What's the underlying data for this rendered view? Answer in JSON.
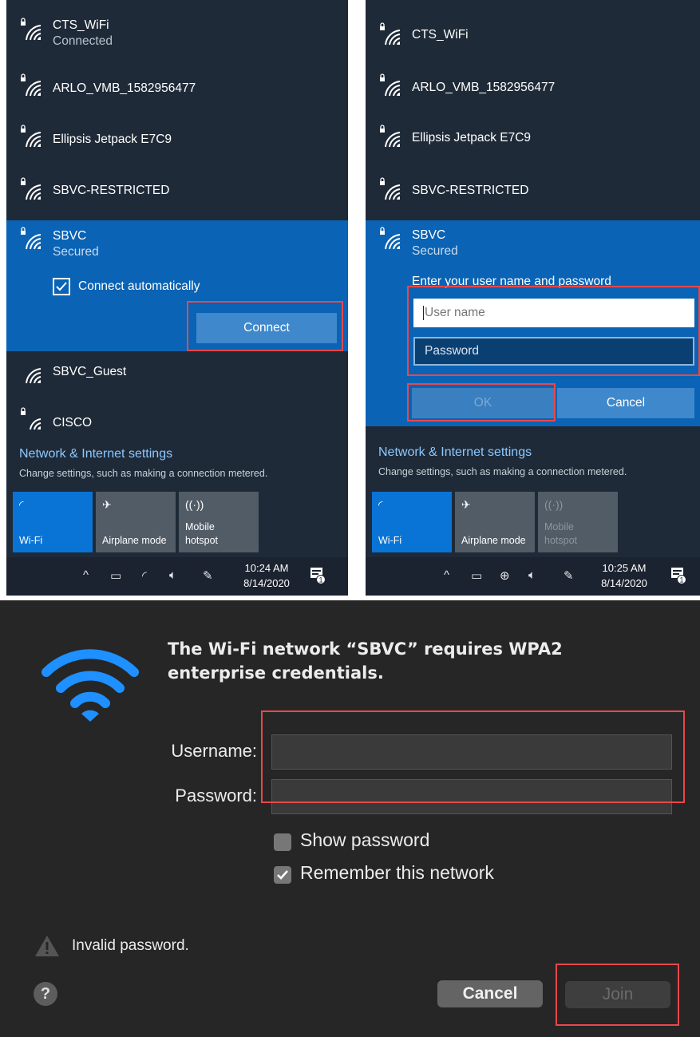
{
  "left_panel": {
    "networks": [
      {
        "name": "CTS_WiFi",
        "status": "Connected",
        "secured": true
      },
      {
        "name": "ARLO_VMB_1582956477",
        "status": "",
        "secured": true
      },
      {
        "name": "Ellipsis Jetpack E7C9",
        "status": "",
        "secured": true
      },
      {
        "name": "SBVC-RESTRICTED",
        "status": "",
        "secured": true
      }
    ],
    "selected": {
      "name": "SBVC",
      "status": "Secured",
      "connect_auto_label": "Connect automatically",
      "connect_auto_checked": true,
      "connect_button": "Connect"
    },
    "more_networks": [
      {
        "name": "SBVC_Guest",
        "secured": false
      },
      {
        "name": "CISCO",
        "secured": true
      }
    ],
    "settings_link": "Network & Internet settings",
    "settings_sub": "Change settings, such as making a connection metered.",
    "tiles": [
      {
        "label": "Wi-Fi",
        "active": true
      },
      {
        "label": "Airplane mode",
        "active": false
      },
      {
        "label": "Mobile\nhotspot",
        "active": false
      }
    ],
    "clock": {
      "time": "10:24 AM",
      "date": "8/14/2020"
    },
    "notification_count": "1"
  },
  "right_panel": {
    "networks": [
      {
        "name": "CTS_WiFi"
      },
      {
        "name": "ARLO_VMB_1582956477"
      },
      {
        "name": "Ellipsis Jetpack E7C9"
      },
      {
        "name": "SBVC-RESTRICTED"
      }
    ],
    "selected": {
      "name": "SBVC",
      "status": "Secured",
      "prompt": "Enter your user name and password"
    },
    "username_placeholder": "User name",
    "password_placeholder": "Password",
    "ok_button": "OK",
    "cancel_button": "Cancel",
    "settings_link": "Network & Internet settings",
    "settings_sub": "Change settings, such as making a connection metered.",
    "tiles": [
      {
        "label": "Wi-Fi",
        "active": true
      },
      {
        "label": "Airplane mode",
        "active": false
      },
      {
        "label": "Mobile\nhotspot",
        "active": false,
        "disabled": true
      }
    ],
    "clock": {
      "time": "10:25 AM",
      "date": "8/14/2020"
    },
    "notification_count": "1"
  },
  "mac_dialog": {
    "title": "The Wi-Fi network “SBVC” requires WPA2 enterprise credentials.",
    "username_label": "Username:",
    "password_label": "Password:",
    "username_value": "",
    "password_value": "",
    "show_password_label": "Show password",
    "show_password_checked": false,
    "remember_label": "Remember this network",
    "remember_checked": true,
    "warning": "Invalid password.",
    "help_label": "?",
    "cancel_button": "Cancel",
    "join_button": "Join"
  },
  "colors": {
    "win_bg": "#1f2a38",
    "win_selected": "#0a63b4",
    "win_accent": "#0a74d6",
    "link": "#8cc8ff",
    "highlight": "#e8484b",
    "mac_bg": "#262626",
    "mac_wifi": "#1e90ff"
  },
  "icons": [
    "wifi-secured-icon",
    "wifi-icon",
    "checkbox-checked-icon",
    "airplane-icon",
    "hotspot-icon",
    "chevron-up-icon",
    "battery-icon",
    "globe-icon",
    "volume-icon",
    "pen-icon",
    "notification-icon",
    "warning-icon",
    "help-icon"
  ]
}
